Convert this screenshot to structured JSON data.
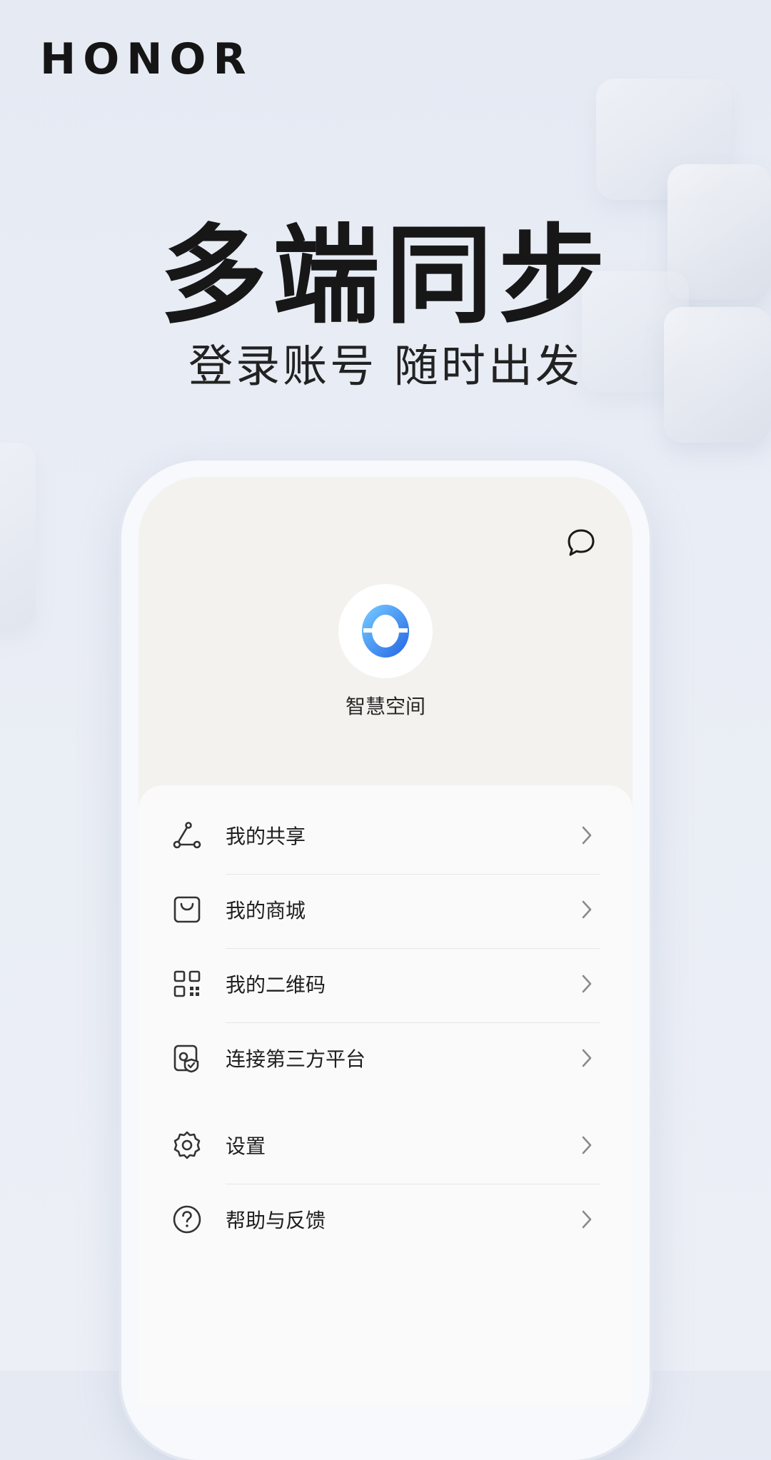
{
  "brand": {
    "logo_text": "HONOR"
  },
  "hero": {
    "title": "多端同步",
    "subtitle": "登录账号 随时出发"
  },
  "phone": {
    "message_icon": "message-bubble-icon",
    "app": {
      "icon": "smart-space-logo-icon",
      "name": "智慧空间",
      "accent": "#3b8ef0"
    },
    "menu": [
      {
        "label": "我的共享",
        "icon": "share-icon"
      },
      {
        "label": "我的商城",
        "icon": "shopping-bag-icon"
      },
      {
        "label": "我的二维码",
        "icon": "qr-code-icon"
      },
      {
        "label": "连接第三方平台",
        "icon": "third-party-shield-icon"
      },
      {
        "label": "设置",
        "icon": "gear-icon"
      },
      {
        "label": "帮助与反馈",
        "icon": "help-icon"
      }
    ]
  }
}
